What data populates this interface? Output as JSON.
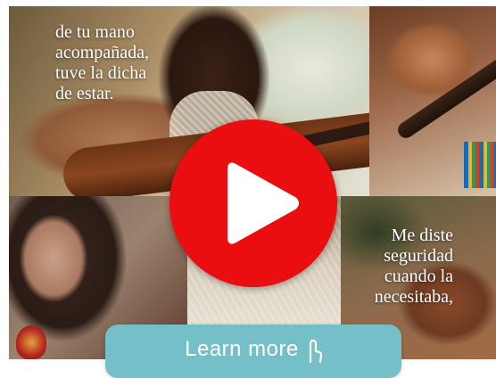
{
  "video": {
    "caption_left": [
      "de tu mano",
      "acompañada,",
      "tuve la dicha",
      "de estar."
    ],
    "caption_right": [
      "Me diste",
      "seguridad",
      "cuando la",
      "necesitaba,"
    ],
    "play_icon": "play-icon"
  },
  "cta": {
    "label": "Learn more",
    "icon": "pointer-hand-icon"
  },
  "colors": {
    "play_button": "#ea0e10",
    "cta_background": "#75bfc8",
    "caption_text": "#ffffff"
  }
}
